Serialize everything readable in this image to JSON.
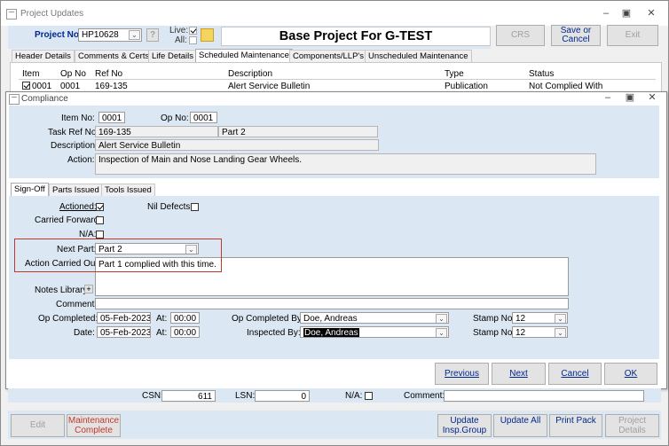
{
  "window": {
    "title": "Project Updates",
    "min": "–",
    "restore": "▣",
    "close": "✕"
  },
  "header": {
    "project_no_label": "Project No:",
    "project_no_value": "HP10628",
    "live_label": "Live:",
    "all_label": "All:",
    "project_title": "Base Project For G-TEST",
    "crs": "CRS",
    "save_or_cancel": "Save or Cancel",
    "exit": "Exit",
    "help": "?"
  },
  "tabs": [
    "Header Details",
    "Comments & Certs",
    "Life Details",
    "Scheduled Maintenance",
    "Components/LLP's",
    "Unscheduled Maintenance"
  ],
  "grid": {
    "columns": [
      "Item",
      "Op No",
      "Ref No",
      "Description",
      "Type",
      "Status"
    ],
    "row": [
      "0001",
      "0001",
      "169-135",
      "Alert Service Bulletin",
      "Publication",
      "Not Complied With"
    ]
  },
  "dialog": {
    "title": "Compliance",
    "item_no_label": "Item No:",
    "item_no": "0001",
    "op_no_label": "Op No:",
    "op_no": "0001",
    "task_ref_label": "Task Ref No:",
    "task_ref": "169-135",
    "task_ref_part": "Part 2",
    "description_label": "Description:",
    "description": "Alert Service Bulletin",
    "action_label": "Action:",
    "action": "Inspection of Main and Nose Landing Gear Wheels.",
    "subtabs": [
      "Sign-Off",
      "Parts Issued",
      "Tools Issued"
    ],
    "actioned_label": "Actioned:",
    "nil_defects_label": "Nil Defects:",
    "carried_forward_label": "Carried Forward:",
    "na_label": "N/A:",
    "next_part_label": "Next Part:",
    "next_part": "Part 2",
    "action_carried_out_label": "Action Carried Out:",
    "action_carried_out": "Part 1 complied with this time.",
    "notes_library_label": "Notes Library",
    "comment_label": "Comment:",
    "op_completed_label": "Op Completed:",
    "op_completed_date": "05-Feb-2023",
    "at_label": "At:",
    "op_completed_time": "00:00",
    "op_completed_by_label": "Op Completed By:",
    "op_completed_by": "Doe, Andreas",
    "stamp_no_label": "Stamp No:",
    "stamp_no_1": "12",
    "date_label": "Date:",
    "date": "05-Feb-2023",
    "date_time": "00:00",
    "inspected_by_label": "Inspected By:",
    "inspected_by": "Doe, Andreas",
    "stamp_no_2": "12",
    "buttons": {
      "previous": "Previous",
      "next": "Next",
      "cancel": "Cancel",
      "ok": "OK"
    }
  },
  "lower": {
    "csn_label": "CSN:",
    "csn": "611",
    "lsn_label": "LSN:",
    "lsn": "0",
    "na_label": "N/A:",
    "comment_label": "Comment:"
  },
  "footer": {
    "edit": "Edit",
    "maintenance_complete": "Maintenance Complete",
    "update_insp_group": "Update Insp.Group",
    "update_all": "Update All",
    "print_pack": "Print Pack",
    "project_details": "Project Details"
  },
  "colors": {
    "band": "#dbe7f3",
    "accent": "#00278d",
    "highlight": "#c0392b"
  }
}
